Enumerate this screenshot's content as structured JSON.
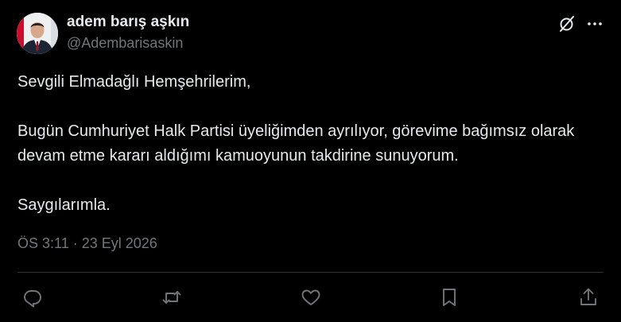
{
  "tweet": {
    "author": {
      "display_name": "adem barış aşkın",
      "handle": "@Adembarisaskin",
      "avatar_icon": "profile-photo"
    },
    "body": [
      "Sevgili Elmadağlı Hemşehrilerim,",
      "Bugün Cumhuriyet Halk Partisi üyeliğimden ayrılıyor, görevime bağımsız olarak devam etme kararı aldığımı kamuoyunun takdirine sunuyorum.",
      "Saygılarımla."
    ],
    "timestamp": "ÖS 3:11 · 23 Eyl 2026",
    "header_icons": [
      "grok-icon",
      "more-icon"
    ],
    "actions": [
      "reply-icon",
      "retweet-icon",
      "like-icon",
      "bookmark-icon",
      "share-icon"
    ],
    "colors": {
      "background": "#000000",
      "primary_text": "#e7e9ea",
      "secondary_text": "#71767b",
      "divider": "#2f3336"
    }
  }
}
